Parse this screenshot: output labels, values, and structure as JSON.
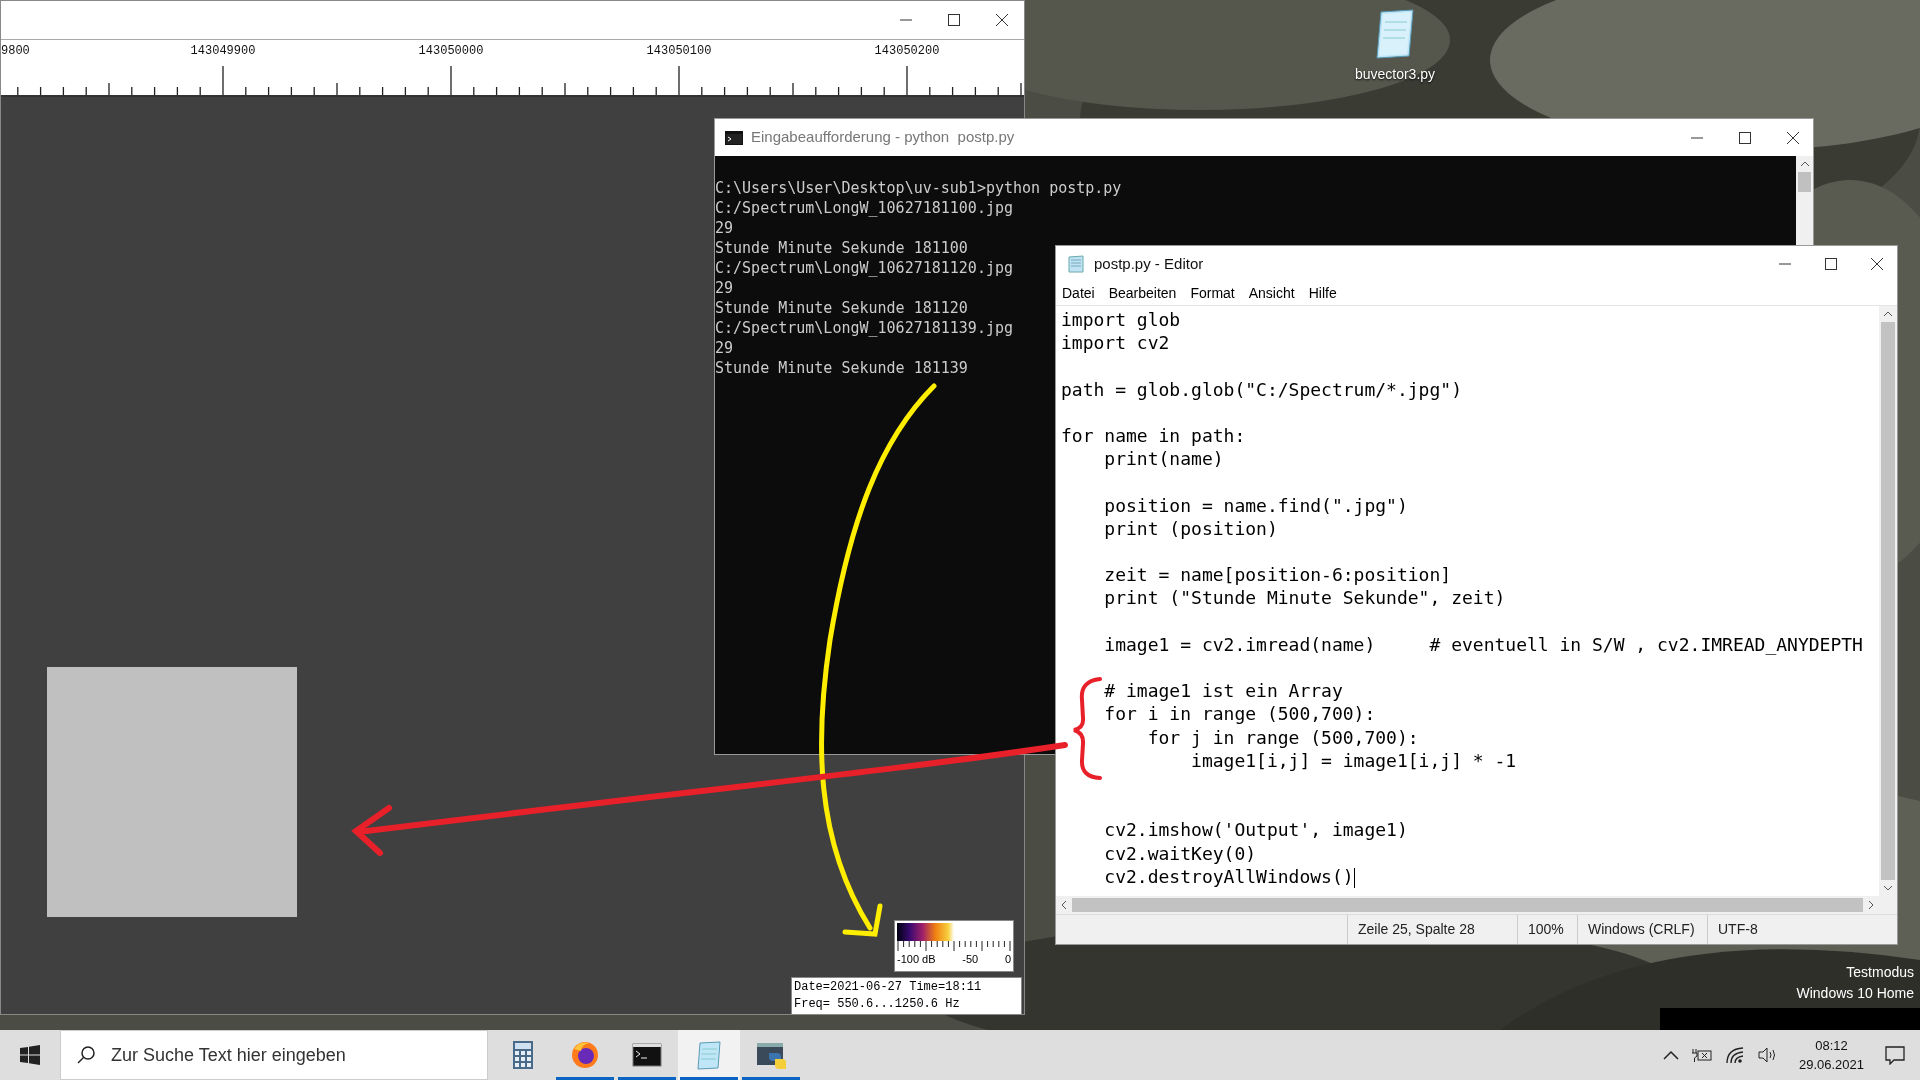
{
  "desktop_icon": {
    "label": "buvector3.py"
  },
  "spectrum_window": {
    "ruler_labels": [
      "9800",
      "143049900",
      "143050000",
      "143050100",
      "143050200"
    ],
    "colorbar_labels": [
      "-100 dB",
      "-50",
      "0"
    ],
    "info_lines": [
      "Date=2021-06-27 Time=18:11",
      "Freq= 550.6...1250.6 Hz"
    ]
  },
  "console_window": {
    "title": "Eingabeaufforderung - python  postp.py",
    "output_lines": [
      "C:\\Users\\User\\Desktop\\uv-sub1>python postp.py",
      "C:/Spectrum\\LongW_10627181100.jpg",
      "29",
      "Stunde Minute Sekunde 181100",
      "C:/Spectrum\\LongW_10627181120.jpg",
      "29",
      "Stunde Minute Sekunde 181120",
      "C:/Spectrum\\LongW_10627181139.jpg",
      "29",
      "Stunde Minute Sekunde 181139"
    ]
  },
  "editor_window": {
    "title": "postp.py - Editor",
    "menu": [
      "Datei",
      "Bearbeiten",
      "Format",
      "Ansicht",
      "Hilfe"
    ],
    "text": "import glob\nimport cv2\n\npath = glob.glob(\"C:/Spectrum/*.jpg\")\n\nfor name in path:\n    print(name)\n\n    position = name.find(\".jpg\")\n    print (position)\n\n    zeit = name[position-6:position]\n    print (\"Stunde Minute Sekunde\", zeit)\n\n    image1 = cv2.imread(name)     # eventuell in S/W , cv2.IMREAD_ANYDEPTH\n\n    # image1 ist ein Array\n    for i in range (500,700):\n        for j in range (500,700):\n            image1[i,j] = image1[i,j] * -1\n\n\n    cv2.imshow('Output', image1)\n    cv2.waitKey(0)\n    cv2.destroyAllWindows()",
    "status": [
      "Zeile 25, Spalte 28",
      "100%",
      "Windows (CRLF)",
      "UTF-8"
    ]
  },
  "system_notice": [
    "Testmodus",
    "Windows 10 Home"
  ],
  "taskbar": {
    "search": {
      "placeholder": "Zur Suche Text hier eingeben"
    },
    "apps": [
      {
        "kind": "calculator",
        "running": false,
        "selected": false
      },
      {
        "kind": "firefox",
        "running": true,
        "selected": false
      },
      {
        "kind": "console",
        "running": true,
        "selected": false
      },
      {
        "kind": "notepad",
        "running": true,
        "selected": true
      },
      {
        "kind": "python",
        "running": true,
        "selected": false
      }
    ],
    "clock": {
      "time": "08:12",
      "date": "29.06.2021"
    }
  }
}
